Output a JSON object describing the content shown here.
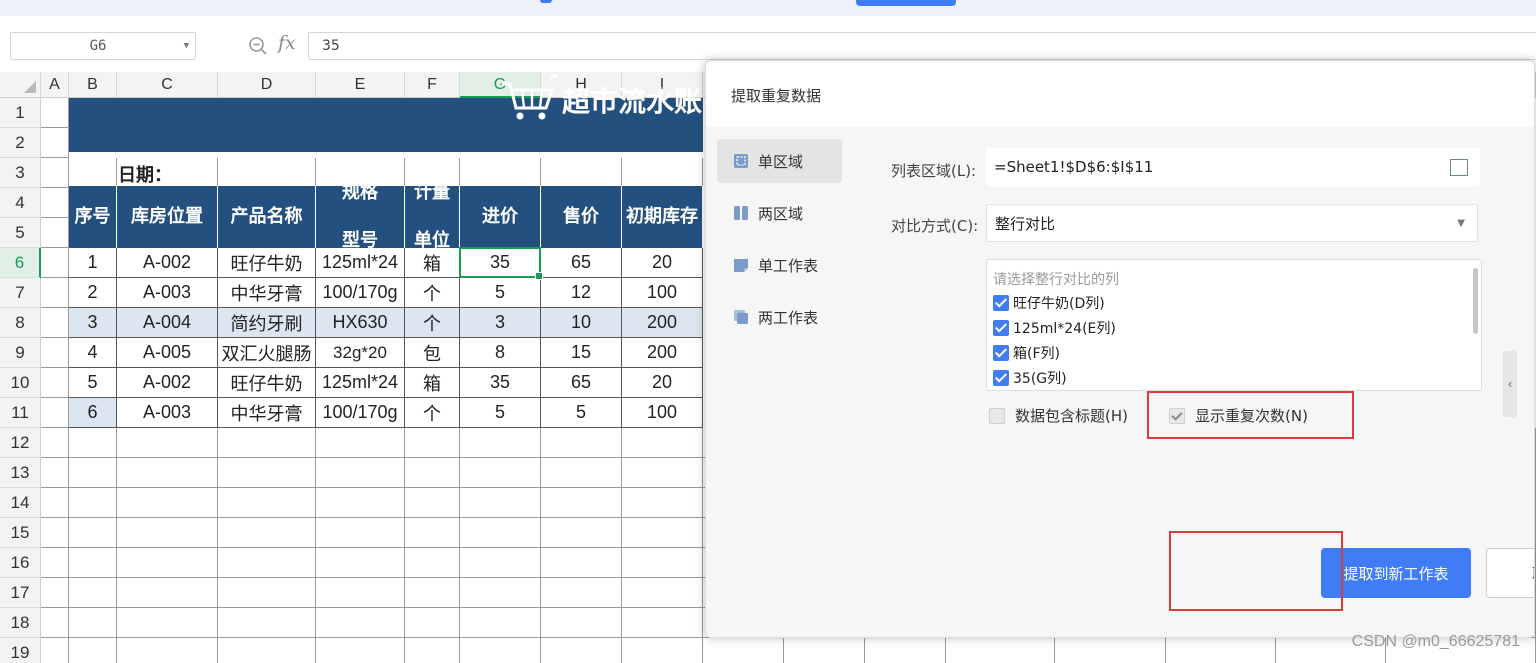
{
  "formula_bar": {
    "cell_ref": "G6",
    "fx_label": "fx",
    "formula": "35"
  },
  "columns": [
    "A",
    "B",
    "C",
    "D",
    "E",
    "F",
    "G",
    "H",
    "I"
  ],
  "selected_column": "G",
  "rows": [
    "1",
    "2",
    "3",
    "4",
    "5",
    "6",
    "7",
    "8",
    "9",
    "10",
    "11",
    "12",
    "13",
    "14",
    "15",
    "16",
    "17",
    "18",
    "19"
  ],
  "selected_row": "6",
  "sheet": {
    "title": "超市流水账",
    "date_label": "日期：",
    "headers": [
      "序号",
      "库房位置",
      "产品名称",
      "规格型号",
      "计量单位",
      "进价",
      "售价",
      "初期库存"
    ],
    "header_lines": {
      "spec": [
        "规格",
        "型号"
      ],
      "unit": [
        "计量",
        "单位"
      ]
    },
    "data": [
      [
        "1",
        "A-002",
        "旺仔牛奶",
        "125ml*24",
        "箱",
        "35",
        "65",
        "20"
      ],
      [
        "2",
        "A-003",
        "中华牙膏",
        "100/170g",
        "个",
        "5",
        "12",
        "100"
      ],
      [
        "3",
        "A-004",
        "简约牙刷",
        "HX630",
        "个",
        "3",
        "10",
        "200"
      ],
      [
        "4",
        "A-005",
        "双汇火腿肠",
        "32g*20",
        "包",
        "8",
        "15",
        "200"
      ],
      [
        "5",
        "A-002",
        "旺仔牛奶",
        "125ml*24",
        "箱",
        "35",
        "65",
        "20"
      ],
      [
        "6",
        "A-003",
        "中华牙膏",
        "100/170g",
        "个",
        "5",
        "5",
        "100"
      ]
    ],
    "highlight_colors": {
      "row3": "#dce6f0",
      "row6_b": "#dce6f0"
    },
    "header_color": "#24507f"
  },
  "dialog": {
    "title": "提取重复数据",
    "sidebar": [
      {
        "label": "单区域",
        "icon": "single-area-icon",
        "active": true
      },
      {
        "label": "两区域",
        "icon": "two-area-icon",
        "active": false
      },
      {
        "label": "单工作表",
        "icon": "single-sheet-icon",
        "active": false
      },
      {
        "label": "两工作表",
        "icon": "two-sheets-icon",
        "active": false
      }
    ],
    "list_range_label": "列表区域(L):",
    "list_range_value": "=Sheet1!$D$6:$I$11",
    "compare_label": "对比方式(C):",
    "compare_value": "整行对比",
    "list_header": "请选择整行对比的列",
    "list_items": [
      "旺仔牛奶(D列)",
      "125ml*24(E列)",
      "箱(F列)",
      "35(G列)"
    ],
    "option_header_label": "数据包含标题(H)",
    "option_count_label": "显示重复次数(N)",
    "primary_button": "提取到新工作表",
    "cancel_button": "取消",
    "accent_color": "#3f7cf5",
    "highlight_color": "#e03b3b"
  },
  "watermark": "CSDN @m0_66625781"
}
